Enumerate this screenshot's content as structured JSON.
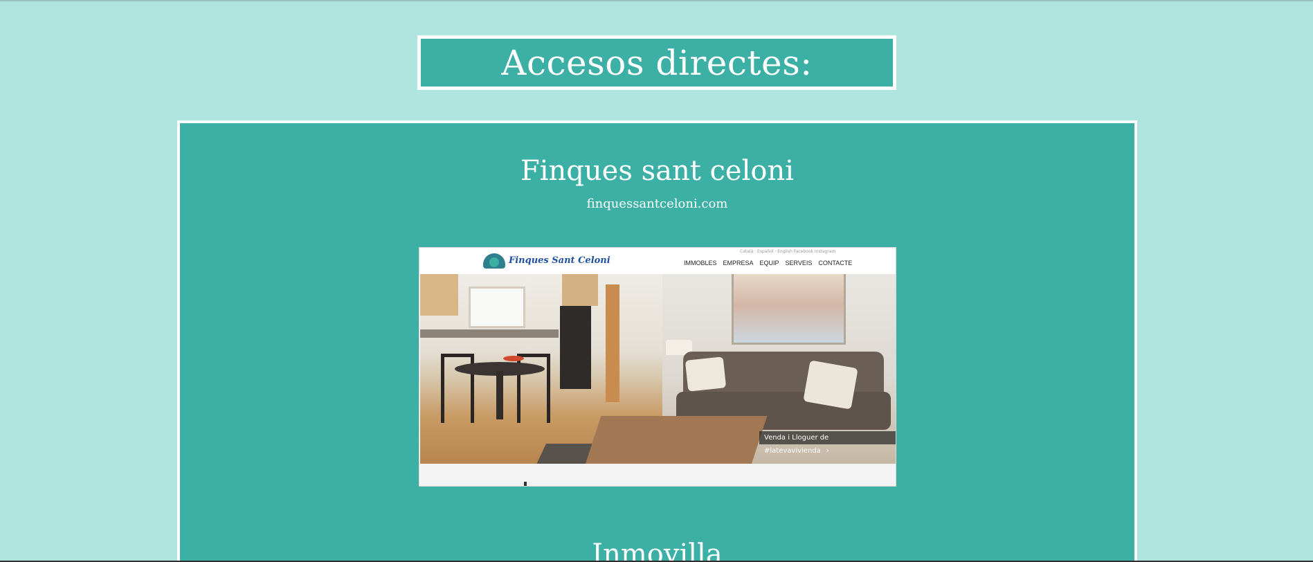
{
  "header": {
    "title": "Accesos directes:"
  },
  "cards": [
    {
      "title": "Finques sant celoni",
      "url": "finquessantceloni.com",
      "preview": {
        "brand": "Finques Sant Celoni",
        "languages": "Català · Español · English   Facebook   Instagram",
        "nav": [
          "IMMOBLES",
          "EMPRESA",
          "EQUIP",
          "SERVEIS",
          "CONTACTE"
        ],
        "caption": "Venda i Lloguer de #latevavivienda",
        "caption_chevron": "›"
      }
    },
    {
      "title": "Inmovilla"
    }
  ]
}
